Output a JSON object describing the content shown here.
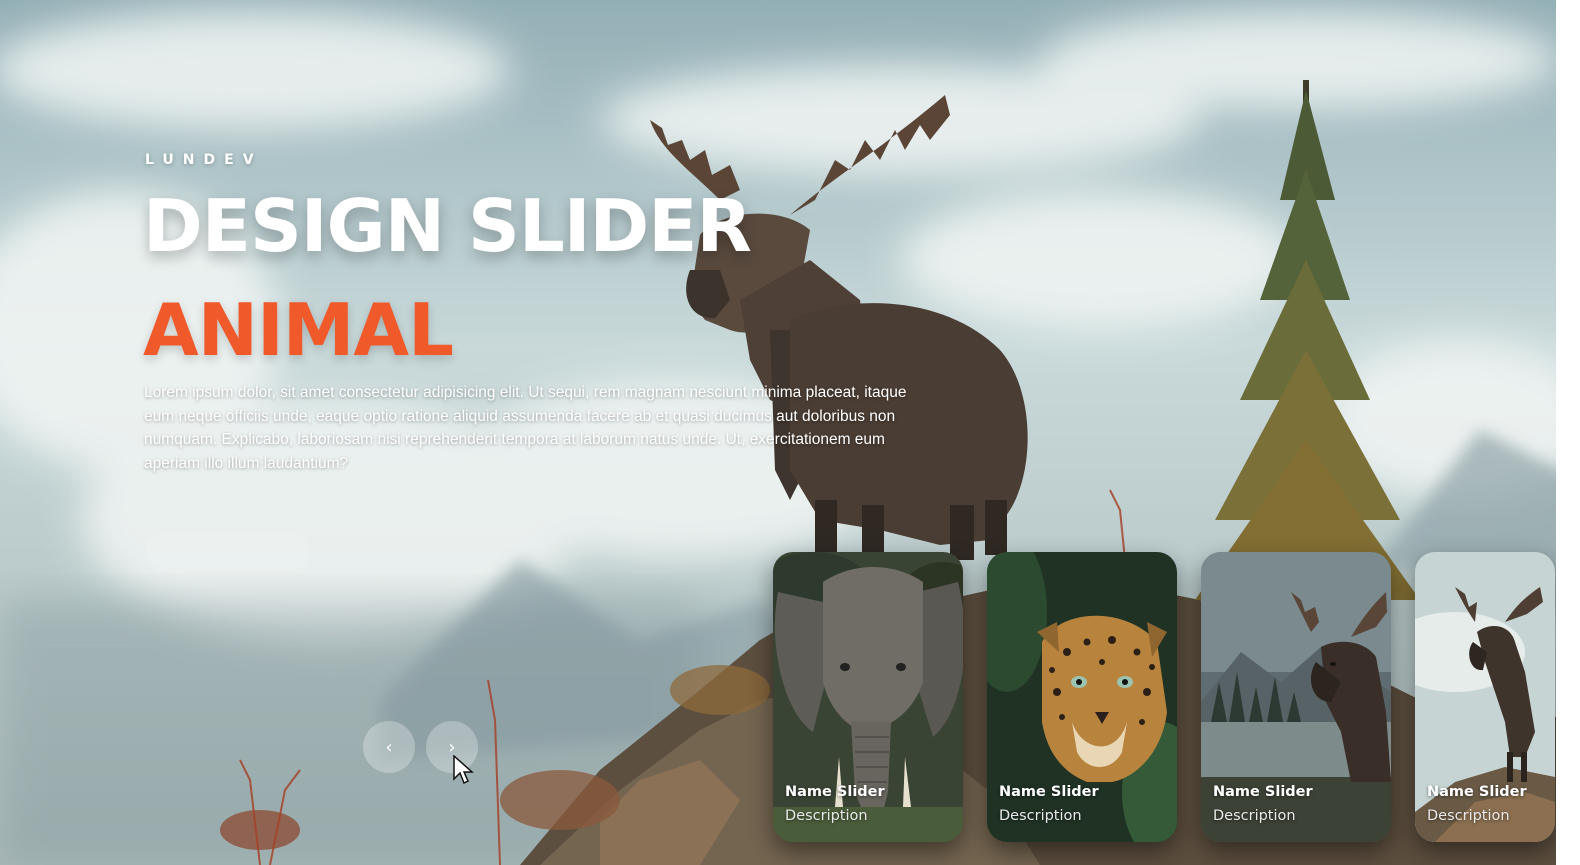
{
  "brand": "LUNDEV",
  "title": "DESIGN SLIDER",
  "topic": "ANIMAL",
  "description": "Lorem ipsum dolor, sit amet consectetur adipisicing elit. Ut sequi, rem magnam nesciunt minima placeat, itaque eum neque officiis unde, eaque optio ratione aliquid assumenda facere ab et quasi ducimus aut doloribus non numquam. Explicabo, laboriosam nisi reprehenderit tempora at laborum natus unde. Ut, exercitationem eum aperiam illo illum laudantium?",
  "ghost_button": "",
  "arrows": {
    "prev": "‹",
    "next": "›"
  },
  "thumbnails": [
    {
      "name": "Name Slider",
      "description": "Description",
      "subject": "elephant"
    },
    {
      "name": "Name Slider",
      "description": "Description",
      "subject": "leopard"
    },
    {
      "name": "Name Slider",
      "description": "Description",
      "subject": "moose-lake"
    },
    {
      "name": "Name Slider",
      "description": "Description",
      "subject": "moose-hill"
    }
  ],
  "colors": {
    "accent": "#f0592a",
    "text": "#ffffff"
  }
}
